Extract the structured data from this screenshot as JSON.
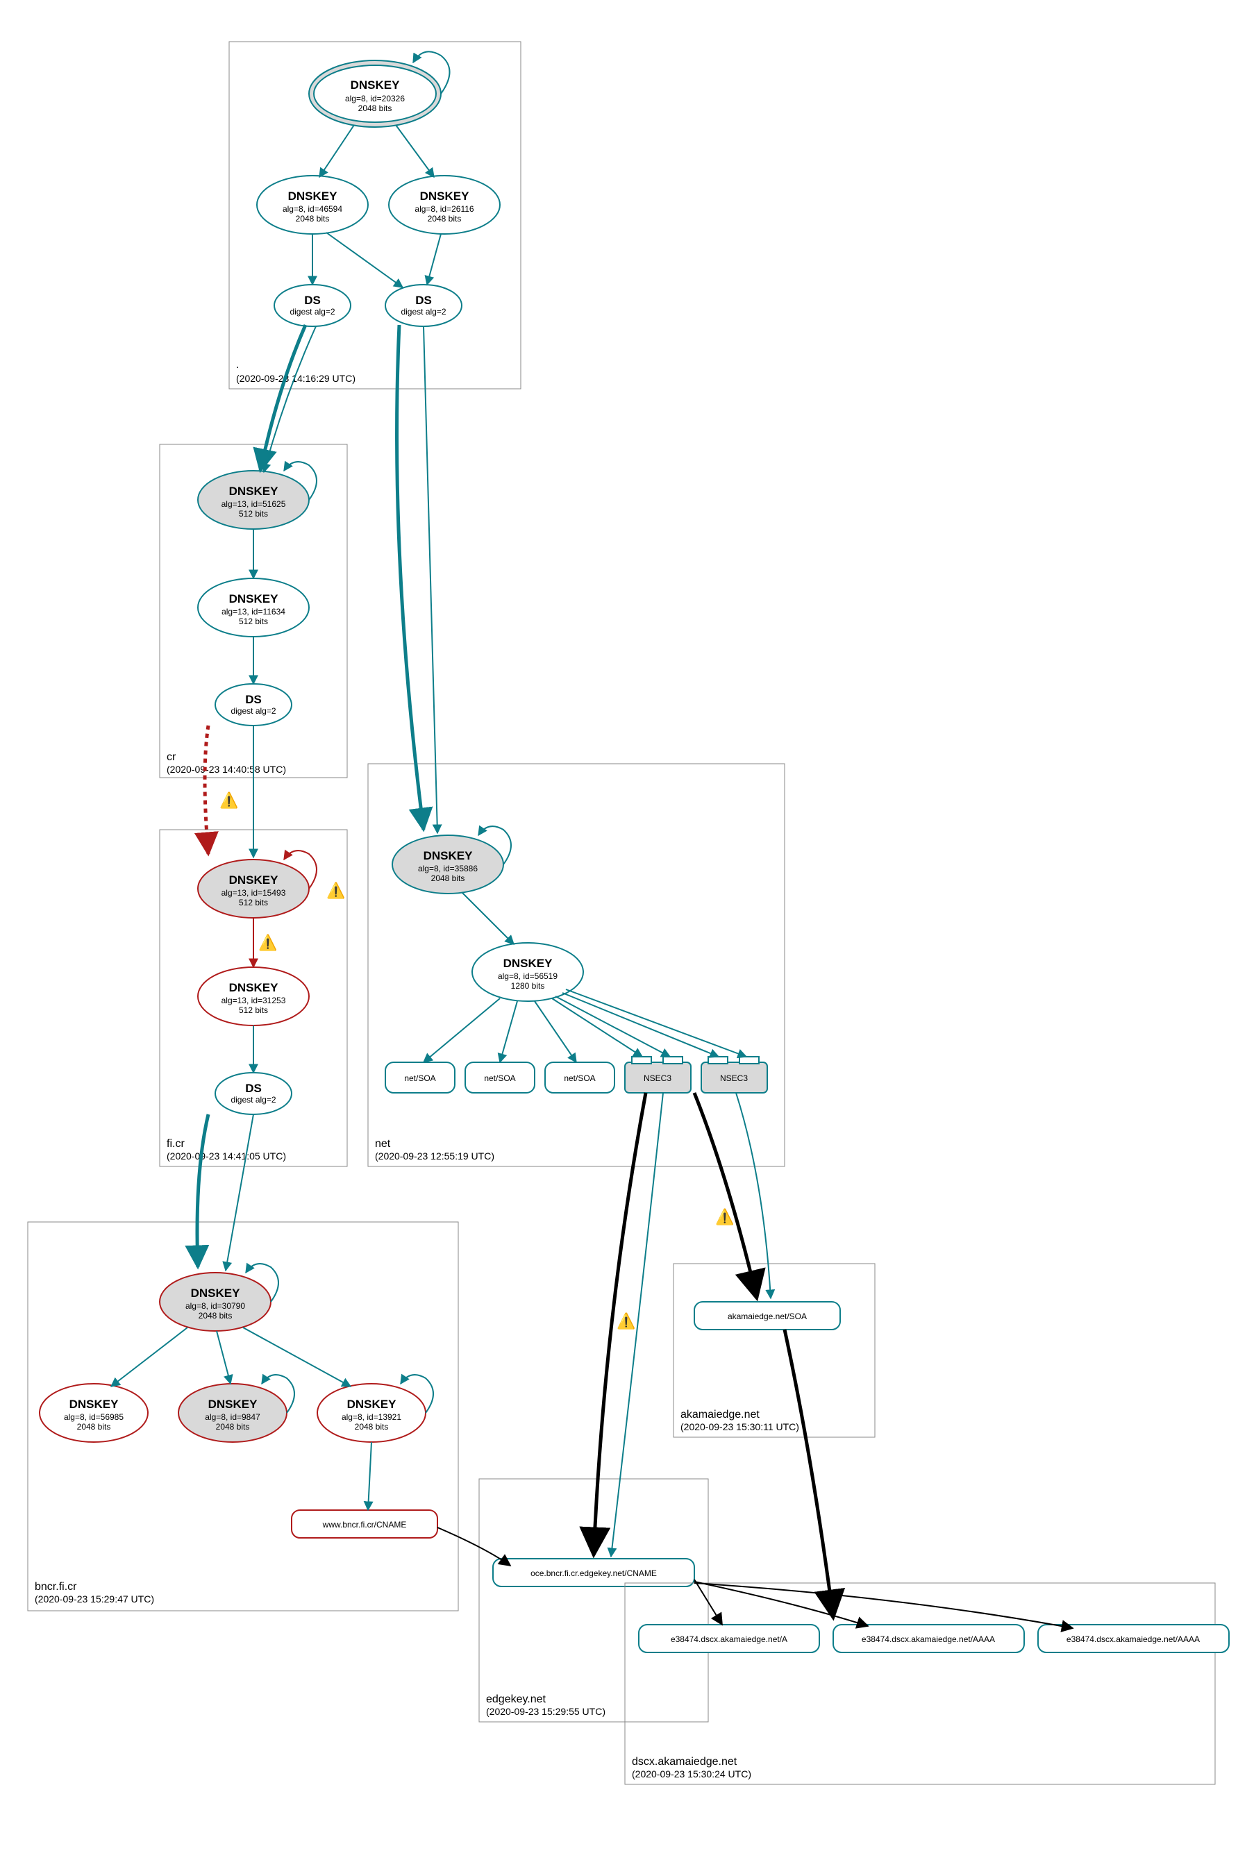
{
  "zones": {
    "root": {
      "name": ".",
      "time": "(2020-09-23 14:16:29 UTC)"
    },
    "cr": {
      "name": "cr",
      "time": "(2020-09-23 14:40:58 UTC)"
    },
    "ficr": {
      "name": "fi.cr",
      "time": "(2020-09-23 14:41:05 UTC)"
    },
    "net": {
      "name": "net",
      "time": "(2020-09-23 12:55:19 UTC)"
    },
    "bncr": {
      "name": "bncr.fi.cr",
      "time": "(2020-09-23 15:29:47 UTC)"
    },
    "akedge": {
      "name": "akamaiedge.net",
      "time": "(2020-09-23 15:30:11 UTC)"
    },
    "edgek": {
      "name": "edgekey.net",
      "time": "(2020-09-23 15:29:55 UTC)"
    },
    "dscx": {
      "name": "dscx.akamaiedge.net",
      "time": "(2020-09-23 15:30:24 UTC)"
    }
  },
  "nodes": {
    "rootKSK": {
      "t": "DNSKEY",
      "l2": "alg=8, id=20326",
      "l3": "2048 bits"
    },
    "root46594": {
      "t": "DNSKEY",
      "l2": "alg=8, id=46594",
      "l3": "2048 bits"
    },
    "root26116": {
      "t": "DNSKEY",
      "l2": "alg=8, id=26116",
      "l3": "2048 bits"
    },
    "rootDS1": {
      "t": "DS",
      "l2": "digest alg=2"
    },
    "rootDS2": {
      "t": "DS",
      "l2": "digest alg=2"
    },
    "crKSK": {
      "t": "DNSKEY",
      "l2": "alg=13, id=51625",
      "l3": "512 bits"
    },
    "cr11634": {
      "t": "DNSKEY",
      "l2": "alg=13, id=11634",
      "l3": "512 bits"
    },
    "crDS": {
      "t": "DS",
      "l2": "digest alg=2"
    },
    "ficrKSK": {
      "t": "DNSKEY",
      "l2": "alg=13, id=15493",
      "l3": "512 bits"
    },
    "ficr31253": {
      "t": "DNSKEY",
      "l2": "alg=13, id=31253",
      "l3": "512 bits"
    },
    "ficrDS": {
      "t": "DS",
      "l2": "digest alg=2"
    },
    "netKSK": {
      "t": "DNSKEY",
      "l2": "alg=8, id=35886",
      "l3": "2048 bits"
    },
    "net56519": {
      "t": "DNSKEY",
      "l2": "alg=8, id=56519",
      "l3": "1280 bits"
    },
    "netSOA1": {
      "t": "net/SOA"
    },
    "netSOA2": {
      "t": "net/SOA"
    },
    "netSOA3": {
      "t": "net/SOA"
    },
    "nsec1": {
      "t": "NSEC3"
    },
    "nsec2": {
      "t": "NSEC3"
    },
    "bncrKSK": {
      "t": "DNSKEY",
      "l2": "alg=8, id=30790",
      "l3": "2048 bits"
    },
    "bncr56985": {
      "t": "DNSKEY",
      "l2": "alg=8, id=56985",
      "l3": "2048 bits"
    },
    "bncr9847": {
      "t": "DNSKEY",
      "l2": "alg=8, id=9847",
      "l3": "2048 bits"
    },
    "bncr13921": {
      "t": "DNSKEY",
      "l2": "alg=8, id=13921",
      "l3": "2048 bits"
    },
    "bncrCNAME": {
      "t": "www.bncr.fi.cr/CNAME"
    },
    "akSOA": {
      "t": "akamaiedge.net/SOA"
    },
    "edgeCNAME": {
      "t": "oce.bncr.fi.cr.edgekey.net/CNAME"
    },
    "dscxA": {
      "t": "e38474.dscx.akamaiedge.net/A"
    },
    "dscxAAAA1": {
      "t": "e38474.dscx.akamaiedge.net/AAAA"
    },
    "dscxAAAA2": {
      "t": "e38474.dscx.akamaiedge.net/AAAA"
    }
  },
  "chart_data": {
    "type": "diagram",
    "description": "DNSSEC authentication chain (DNSViz-style) for www.bncr.fi.cr",
    "zones": [
      {
        "name": ".",
        "timestamp": "2020-09-23 14:16:29 UTC",
        "keys": [
          {
            "type": "DNSKEY",
            "alg": 8,
            "id": 20326,
            "bits": 2048,
            "role": "KSK",
            "status": "secure"
          },
          {
            "type": "DNSKEY",
            "alg": 8,
            "id": 46594,
            "bits": 2048,
            "status": "secure"
          },
          {
            "type": "DNSKEY",
            "alg": 8,
            "id": 26116,
            "bits": 2048,
            "status": "secure"
          }
        ],
        "ds": [
          {
            "digest_alg": 2
          },
          {
            "digest_alg": 2
          }
        ]
      },
      {
        "name": "cr",
        "timestamp": "2020-09-23 14:40:58 UTC",
        "keys": [
          {
            "type": "DNSKEY",
            "alg": 13,
            "id": 51625,
            "bits": 512,
            "role": "KSK",
            "status": "secure"
          },
          {
            "type": "DNSKEY",
            "alg": 13,
            "id": 11634,
            "bits": 512,
            "status": "secure"
          }
        ],
        "ds": [
          {
            "digest_alg": 2
          }
        ]
      },
      {
        "name": "fi.cr",
        "timestamp": "2020-09-23 14:41:05 UTC",
        "delegation_status": "bogus",
        "keys": [
          {
            "type": "DNSKEY",
            "alg": 13,
            "id": 15493,
            "bits": 512,
            "role": "KSK",
            "status": "bogus"
          },
          {
            "type": "DNSKEY",
            "alg": 13,
            "id": 31253,
            "bits": 512,
            "status": "bogus"
          }
        ],
        "ds": [
          {
            "digest_alg": 2
          }
        ]
      },
      {
        "name": "net",
        "timestamp": "2020-09-23 12:55:19 UTC",
        "keys": [
          {
            "type": "DNSKEY",
            "alg": 8,
            "id": 35886,
            "bits": 2048,
            "role": "KSK",
            "status": "secure"
          },
          {
            "type": "DNSKEY",
            "alg": 8,
            "id": 56519,
            "bits": 1280,
            "status": "secure"
          }
        ],
        "records": [
          "net/SOA",
          "net/SOA",
          "net/SOA",
          "NSEC3",
          "NSEC3"
        ]
      },
      {
        "name": "bncr.fi.cr",
        "timestamp": "2020-09-23 15:29:47 UTC",
        "delegation_status": "secure-to-bogus",
        "keys": [
          {
            "type": "DNSKEY",
            "alg": 8,
            "id": 30790,
            "bits": 2048,
            "role": "KSK",
            "status": "bogus"
          },
          {
            "type": "DNSKEY",
            "alg": 8,
            "id": 56985,
            "bits": 2048,
            "status": "bogus"
          },
          {
            "type": "DNSKEY",
            "alg": 8,
            "id": 9847,
            "bits": 2048,
            "role": "KSK",
            "status": "bogus"
          },
          {
            "type": "DNSKEY",
            "alg": 8,
            "id": 13921,
            "bits": 2048,
            "status": "bogus"
          }
        ],
        "records": [
          "www.bncr.fi.cr/CNAME"
        ]
      },
      {
        "name": "akamaiedge.net",
        "timestamp": "2020-09-23 15:30:11 UTC",
        "delegation_status": "insecure",
        "records": [
          "akamaiedge.net/SOA"
        ]
      },
      {
        "name": "edgekey.net",
        "timestamp": "2020-09-23 15:29:55 UTC",
        "delegation_status": "insecure",
        "records": [
          "oce.bncr.fi.cr.edgekey.net/CNAME"
        ]
      },
      {
        "name": "dscx.akamaiedge.net",
        "timestamp": "2020-09-23 15:30:24 UTC",
        "delegation_status": "insecure",
        "records": [
          "e38474.dscx.akamaiedge.net/A",
          "e38474.dscx.akamaiedge.net/AAAA",
          "e38474.dscx.akamaiedge.net/AAAA"
        ]
      }
    ],
    "edges_summary": "Teal = secure RRSIG, Red (dashed) = bogus / validation failure, Black thick = insecure delegation, yellow ⚠ = warning, red ⚠ = error"
  }
}
